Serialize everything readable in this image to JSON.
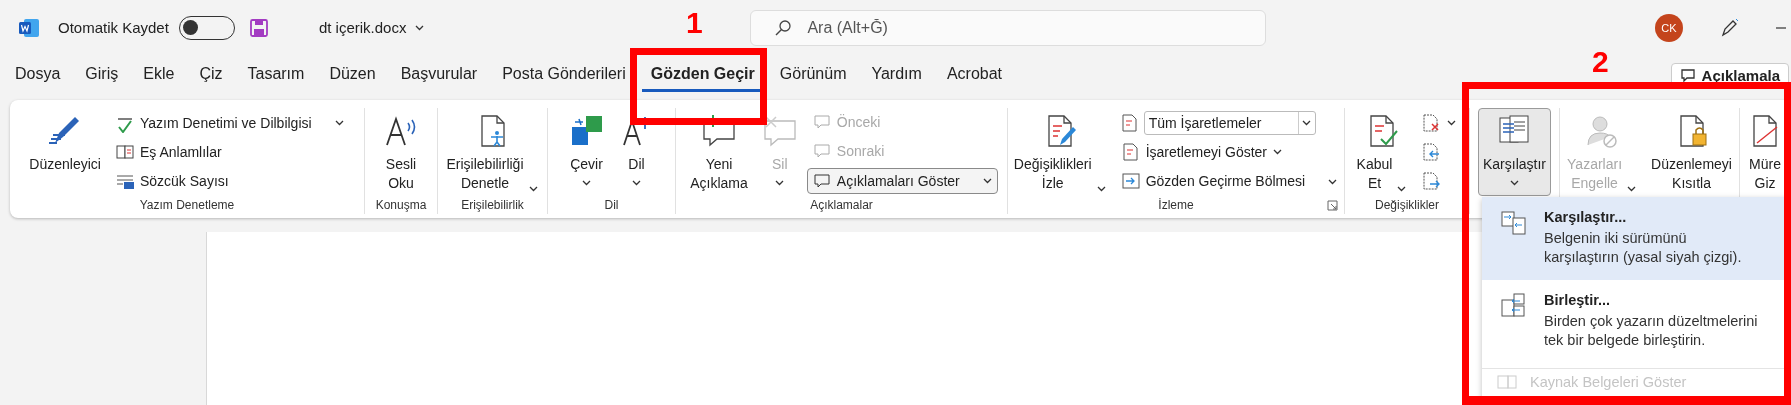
{
  "title_bar": {
    "autosave": {
      "label": "Otomatik Kaydet",
      "on": false
    },
    "file_name": "dt içerik.docx",
    "search": {
      "placeholder": "Ara (Alt+Ğ)"
    },
    "avatar": "CK"
  },
  "tabs": [
    {
      "label": "Dosya",
      "selected": false
    },
    {
      "label": "Giriş",
      "selected": false
    },
    {
      "label": "Ekle",
      "selected": false
    },
    {
      "label": "Çiz",
      "selected": false
    },
    {
      "label": "Tasarım",
      "selected": false
    },
    {
      "label": "Düzen",
      "selected": false
    },
    {
      "label": "Başvurular",
      "selected": false
    },
    {
      "label": "Posta Gönderileri",
      "selected": false
    },
    {
      "label": "Gözden Geçir",
      "selected": true
    },
    {
      "label": "Görünüm",
      "selected": false
    },
    {
      "label": "Yardım",
      "selected": false
    },
    {
      "label": "Acrobat",
      "selected": false
    }
  ],
  "comments_button": {
    "label": "Açıklamala"
  },
  "ribbon": {
    "groups": [
      {
        "label": "Yazım Denetleme",
        "items": [
          {
            "kind": "large",
            "label": "Düzenleyici"
          },
          {
            "kind": "stack",
            "items": [
              {
                "label": "Yazım Denetimi ve Dilbilgisi",
                "caret": true,
                "caret_apart": true
              },
              {
                "label": "Eş Anlamlılar"
              },
              {
                "label": "Sözcük Sayısı"
              }
            ]
          }
        ]
      },
      {
        "label": "Konuşma",
        "items": [
          {
            "kind": "large",
            "label": "Sesli\nOku"
          }
        ]
      },
      {
        "label": "Erişilebilirlik",
        "items": [
          {
            "kind": "large",
            "label": "Erişilebilirliği\nDenetle",
            "caret": true
          }
        ]
      },
      {
        "label": "Dil",
        "items": [
          {
            "kind": "large",
            "label": "Çevir",
            "caret": true,
            "caret_below": true
          },
          {
            "kind": "large",
            "label": "Dil",
            "caret": true,
            "caret_below": true
          }
        ]
      },
      {
        "label": "Açıklamalar",
        "items": [
          {
            "kind": "large",
            "label": "Yeni\nAçıklama"
          },
          {
            "kind": "large",
            "label": "Sil",
            "caret": true,
            "caret_below": true,
            "disabled": true
          },
          {
            "kind": "stack",
            "items": [
              {
                "label": "Önceki",
                "disabled": true
              },
              {
                "label": "Sonraki",
                "disabled": true
              },
              {
                "label": "Açıklamaları Göster",
                "caret": true,
                "caret_apart": true,
                "on": true
              }
            ]
          }
        ]
      },
      {
        "label": "İzleme",
        "launcher": true,
        "items": [
          {
            "kind": "large",
            "label": "Değişiklikleri\nİzle",
            "caret": true
          },
          {
            "kind": "stack",
            "items": [
              {
                "kind": "select",
                "label": "Tüm İşaretlemeler"
              },
              {
                "label": "İşaretlemeyi Göster",
                "caret": true
              },
              {
                "label": "Gözden Geçirme Bölmesi",
                "caret": true,
                "caret_apart": true
              }
            ]
          }
        ]
      },
      {
        "label": "Değişiklikler",
        "items": [
          {
            "kind": "large",
            "label": "Kabul\nEt",
            "caret": true
          },
          {
            "kind": "stack",
            "items": [
              {
                "kind": "icon",
                "caret": true
              },
              {
                "kind": "icon"
              },
              {
                "kind": "icon"
              }
            ]
          }
        ]
      },
      {
        "items": [
          {
            "kind": "large",
            "label": "Karşılaştır",
            "caret": true,
            "caret_below": true,
            "expanded": true
          }
        ]
      },
      {
        "items": [
          {
            "kind": "large",
            "label": "Yazarları\nEngelle",
            "caret": true,
            "disabled": true
          },
          {
            "kind": "large",
            "label": "Düzenlemeyi\nKısıtla"
          }
        ]
      },
      {
        "items": [
          {
            "kind": "large",
            "label": "Müre\nGiz"
          }
        ]
      }
    ]
  },
  "menu": {
    "items": [
      {
        "title": "Karşılaştır...",
        "description": "Belgenin iki sürümünü\nkarşılaştırın (yasal siyah çizgi).",
        "selected": true
      },
      {
        "title": "Birleştir...",
        "description": "Birden çok yazarın düzeltmelerini\ntek bir belgede birleştirin.",
        "selected": false
      },
      {
        "title": "Kaynak Belgeleri Göster",
        "disabled": true
      }
    ]
  },
  "annotations": [
    {
      "number": "1"
    },
    {
      "number": "2"
    }
  ]
}
